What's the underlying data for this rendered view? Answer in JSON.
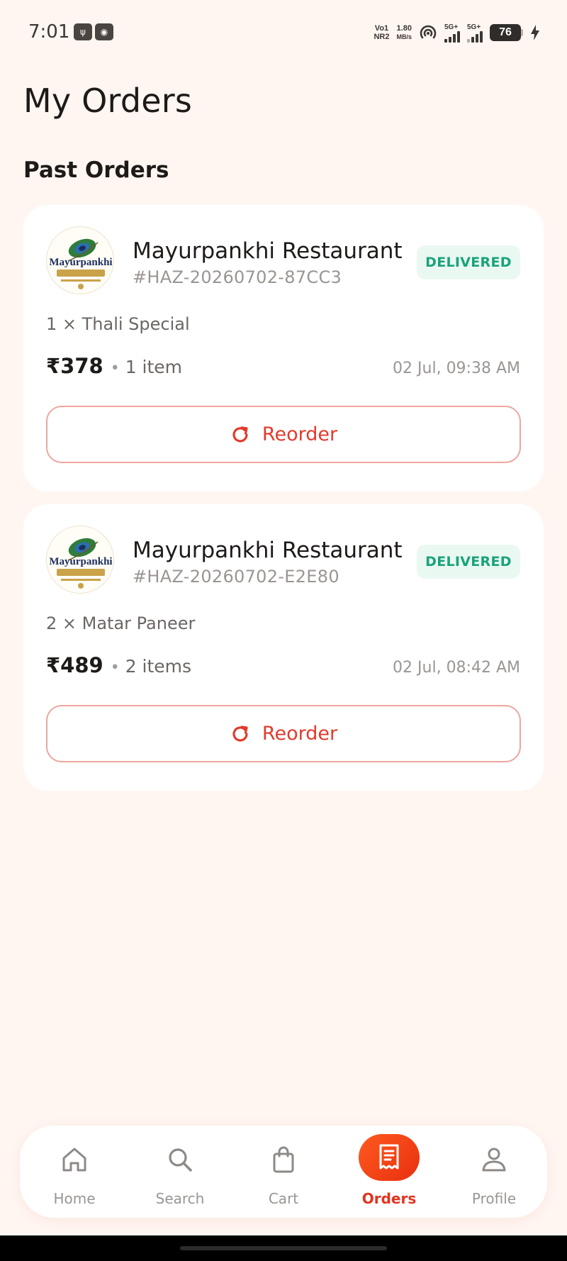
{
  "status_bar": {
    "time": "7:01",
    "network_top": "Vo1",
    "network_bottom": "NR2",
    "speed_value": "1.80",
    "speed_unit": "MB/s",
    "sim1_label": "5G+",
    "sim2_label": "5G+",
    "battery": "76"
  },
  "page": {
    "title": "My Orders",
    "section_title": "Past Orders"
  },
  "orders": [
    {
      "restaurant": "Mayurpankhi Restaurant",
      "logo_text": "Mayurpankhi",
      "order_id": "#HAZ-20260702-87CC3",
      "status": "DELIVERED",
      "items_summary": "1 × Thali Special",
      "price": "₹378",
      "item_count": "1 item",
      "time": "02 Jul, 09:38 AM",
      "reorder_label": "Reorder"
    },
    {
      "restaurant": "Mayurpankhi Restaurant",
      "logo_text": "Mayurpankhi",
      "order_id": "#HAZ-20260702-E2E80",
      "status": "DELIVERED",
      "items_summary": "2 × Matar Paneer",
      "price": "₹489",
      "item_count": "2 items",
      "time": "02 Jul, 08:42 AM",
      "reorder_label": "Reorder"
    }
  ],
  "nav": {
    "items": [
      {
        "label": "Home",
        "icon": "home-icon"
      },
      {
        "label": "Search",
        "icon": "search-icon"
      },
      {
        "label": "Cart",
        "icon": "cart-icon"
      },
      {
        "label": "Orders",
        "icon": "orders-icon",
        "active": true
      },
      {
        "label": "Profile",
        "icon": "profile-icon"
      }
    ]
  },
  "colors": {
    "background": "#fff6f2",
    "accent": "#e4331f",
    "delivered": "#1aa37a"
  }
}
